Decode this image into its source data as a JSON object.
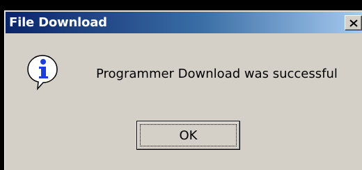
{
  "window": {
    "title": "File Download"
  },
  "dialog": {
    "message": "Programmer Download was successful",
    "icon": "information-icon"
  },
  "buttons": {
    "ok_label": "OK",
    "close_icon": "close-icon"
  },
  "colors": {
    "title_gradient_start": "#0a246a",
    "title_gradient_end": "#a6caf0",
    "face": "#d4d0c8",
    "icon_blue": "#1a3ee0"
  }
}
